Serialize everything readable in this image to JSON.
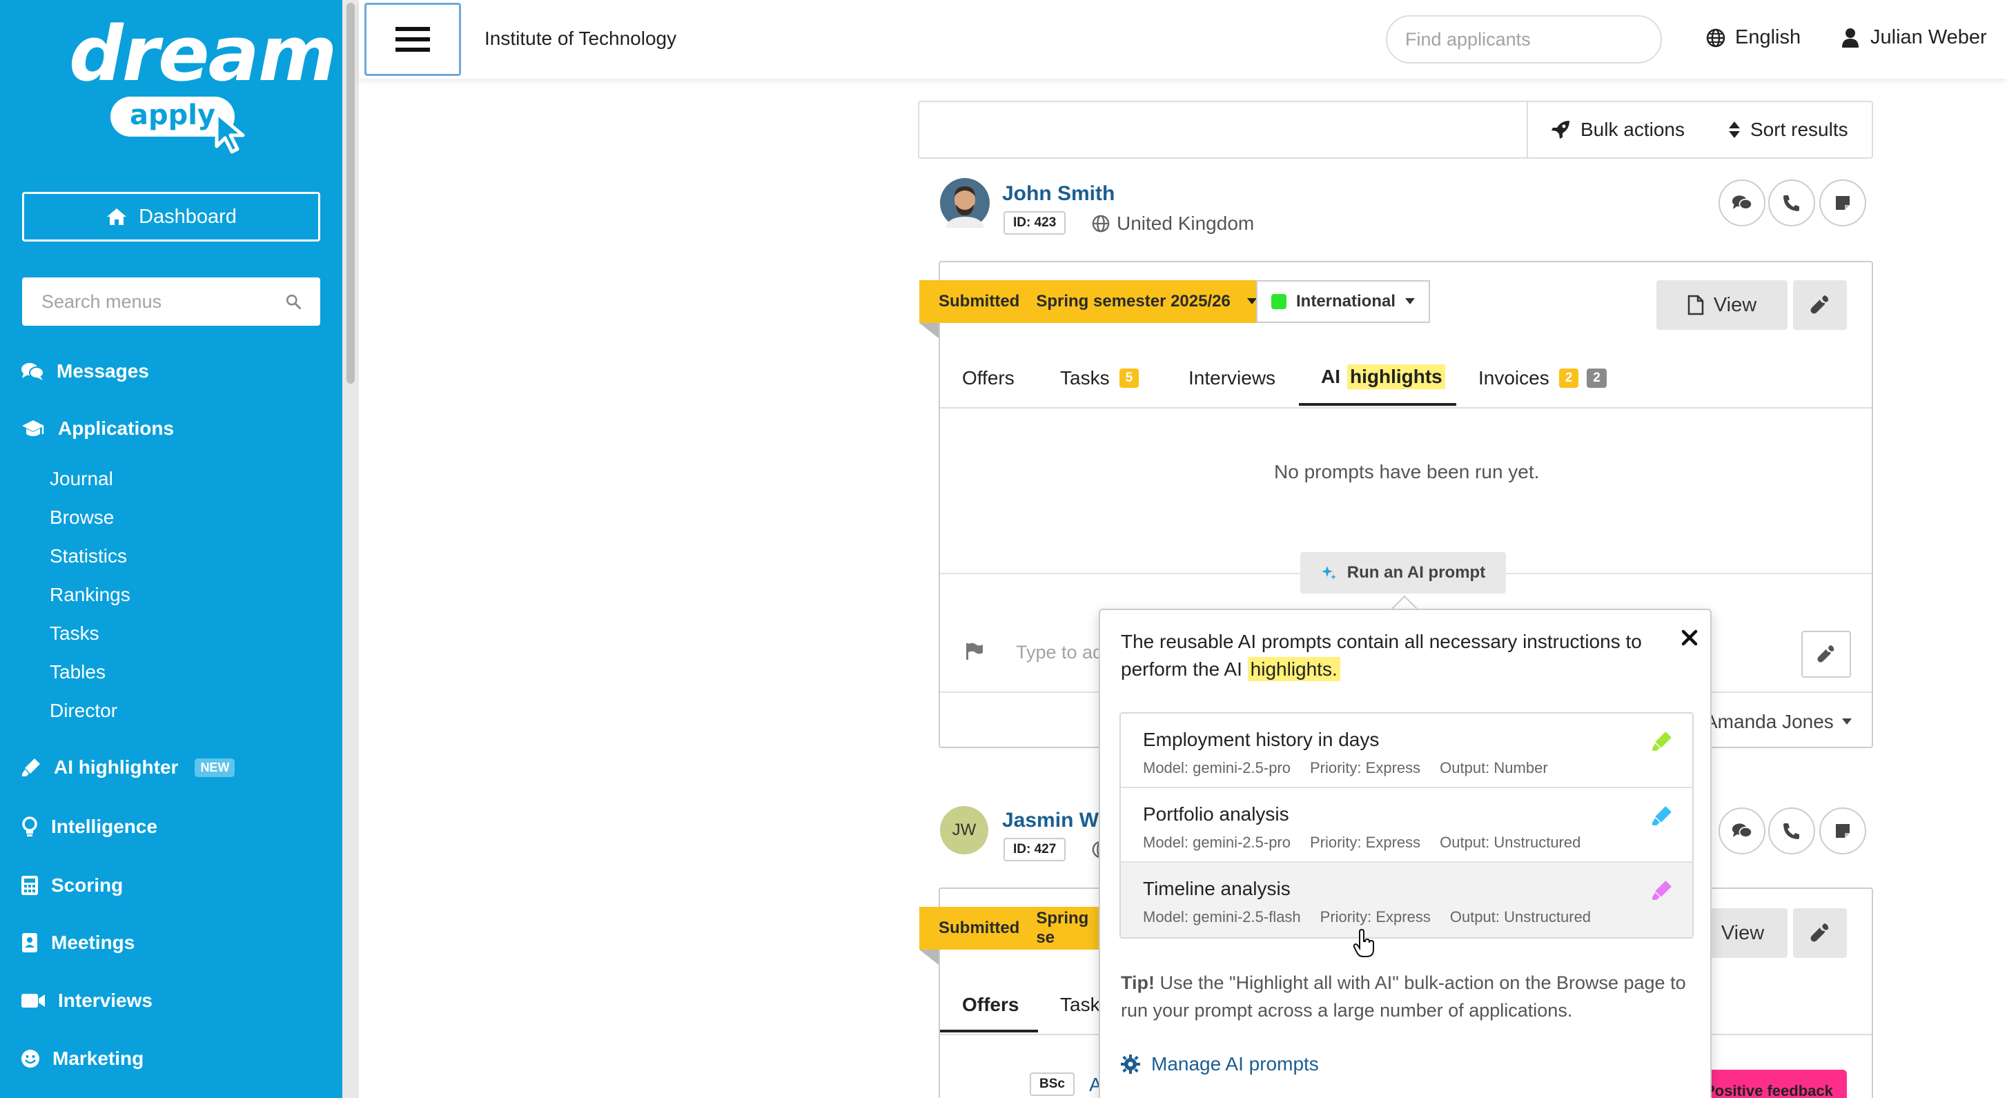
{
  "sidebar": {
    "logo_main": "dream",
    "logo_sub": "apply",
    "dashboard_label": "Dashboard",
    "search_placeholder": "Search menus",
    "nav": {
      "messages": "Messages",
      "applications": "Applications",
      "ai_highlighter": "AI highlighter",
      "ai_highlighter_badge": "NEW",
      "intelligence": "Intelligence",
      "scoring": "Scoring",
      "meetings": "Meetings",
      "interviews": "Interviews",
      "marketing": "Marketing"
    },
    "applications_sub": {
      "journal": "Journal",
      "browse": "Browse",
      "statistics": "Statistics",
      "rankings": "Rankings",
      "tasks": "Tasks",
      "tables": "Tables",
      "director": "Director"
    }
  },
  "topbar": {
    "institute": "Institute of Technology",
    "search_placeholder": "Find applicants",
    "language": "English",
    "user": "Julian Weber"
  },
  "toolbar": {
    "bulk_actions": "Bulk actions",
    "sort_results": "Sort results"
  },
  "applicant1": {
    "name": "John Smith",
    "id": "ID: 423",
    "country": "United Kingdom",
    "status": "Submitted",
    "semester": "Spring semester 2025/26",
    "category": "International",
    "category_color": "#2ee52e",
    "view_label": "View",
    "tabs": {
      "offers": "Offers",
      "tasks": "Tasks",
      "tasks_count": "5",
      "interviews": "Interviews",
      "ai_prefix": "AI",
      "ai_highlight": "highlights",
      "invoices": "Invoices",
      "invoices_count1": "2",
      "invoices_count2": "2"
    },
    "no_prompts": "No prompts have been run yet.",
    "run_prompt": "Run an AI prompt",
    "comment_placeholder": "Type to ad",
    "assignee": "Amanda Jones"
  },
  "applicant2": {
    "initials": "JW",
    "name": "Jasmin We",
    "id": "ID: 427",
    "status": "Submitted",
    "semester": "Spring se",
    "view_label": "View",
    "tab_offers": "Offers",
    "tab_tasks": "Task",
    "degree_badge": "BSc",
    "degree_fragment": "A",
    "feedback": "Positive feedback"
  },
  "popover": {
    "intro_text": "The reusable AI prompts contain all necessary instructions to perform the AI",
    "intro_highlight": "highlights.",
    "prompts": [
      {
        "title": "Employment history in days",
        "model": "Model: gemini-2.5-pro",
        "priority": "Priority: Express",
        "output": "Output: Number",
        "icon_color": "#a3e635"
      },
      {
        "title": "Portfolio analysis",
        "model": "Model: gemini-2.5-pro",
        "priority": "Priority: Express",
        "output": "Output: Unstructured",
        "icon_color": "#38bdf8"
      },
      {
        "title": "Timeline analysis",
        "model": "Model: gemini-2.5-flash",
        "priority": "Priority: Express",
        "output": "Output: Unstructured",
        "icon_color": "#e879f9"
      }
    ],
    "tip_label": "Tip!",
    "tip_text": " Use the \"Highlight all with AI\" bulk-action on the Browse page to run your prompt across a large number of applications.",
    "manage_label": "Manage AI prompts"
  },
  "colors": {
    "sidebar_bg": "#0aa0db",
    "accent_link": "#1b5e91",
    "status_yellow": "#f9c11a",
    "highlight_yellow": "#fff17a",
    "feedback_pink": "#ff2d8a"
  }
}
